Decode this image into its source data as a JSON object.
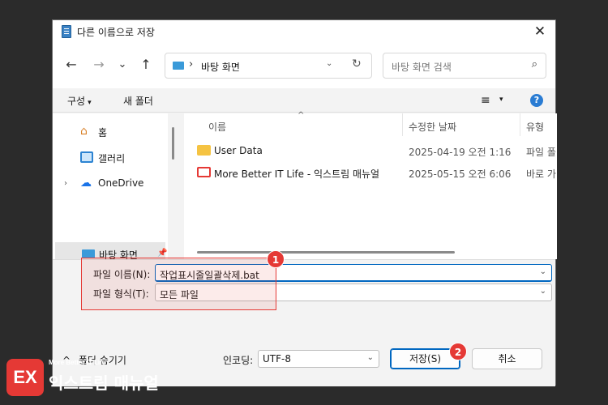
{
  "window": {
    "title": "다른 이름으로 저장",
    "close_glyph": "✕"
  },
  "nav": {
    "back_glyph": "←",
    "forward_glyph": "→",
    "recent_glyph": "⌄",
    "up_glyph": "↑",
    "breadcrumb_sep": "›",
    "path": "바탕 화면",
    "address_dropdown_glyph": "⌄",
    "refresh_glyph": "↻",
    "search_placeholder": "바탕 화면 검색",
    "search_glyph": "⌕"
  },
  "toolbar": {
    "organize_label": "구성",
    "organize_caret": "▾",
    "new_folder_label": "새 폴더",
    "view_glyph": "≡",
    "view_caret": "▾",
    "help_glyph": "?"
  },
  "sidebar": {
    "items": [
      {
        "label": "홈",
        "icon": "home-icon",
        "glyph": "⌂"
      },
      {
        "label": "갤러리",
        "icon": "gallery-icon"
      },
      {
        "label": "OneDrive",
        "icon": "onedrive-icon",
        "glyph": "☁",
        "expand_glyph": "›"
      },
      {
        "label": "바탕 화면",
        "icon": "desktop-icon",
        "selected": true,
        "pin_glyph": "📌"
      }
    ]
  },
  "filelist": {
    "sort_glyph": "^",
    "columns": [
      "이름",
      "수정한 날짜",
      "유형"
    ],
    "rows": [
      {
        "name": "User Data",
        "date": "2025-04-19 오전 1:16",
        "type": "파일 폴",
        "icon": "folder-icon"
      },
      {
        "name": "More Better IT Life - 익스트림 매뉴얼",
        "date": "2025-05-15 오전 6:06",
        "type": "바로 가",
        "icon": "shortcut-icon"
      }
    ]
  },
  "form": {
    "filename_label": "파일 이름(N):",
    "filename_value": "작업표시줄일괄삭제.bat",
    "filetype_label": "파일 형식(T):",
    "filetype_value": "모든 파일",
    "chevron_glyph": "⌄"
  },
  "footer": {
    "hide_folders_caret": "^",
    "hide_folders_label": "폴더 숨기기",
    "encoding_label": "인코딩:",
    "encoding_value": "UTF-8",
    "encoding_chevron": "⌄",
    "save_label": "저장(S)",
    "cancel_label": "취소"
  },
  "annotations": {
    "badge1": "1",
    "badge2": "2"
  },
  "watermark": {
    "mark": "EX",
    "tagline": "More Better IT Life",
    "name": "익스트림 매뉴얼"
  },
  "colors": {
    "accent": "#0067c0",
    "highlight": "#e53935",
    "folder": "#f5c342"
  }
}
